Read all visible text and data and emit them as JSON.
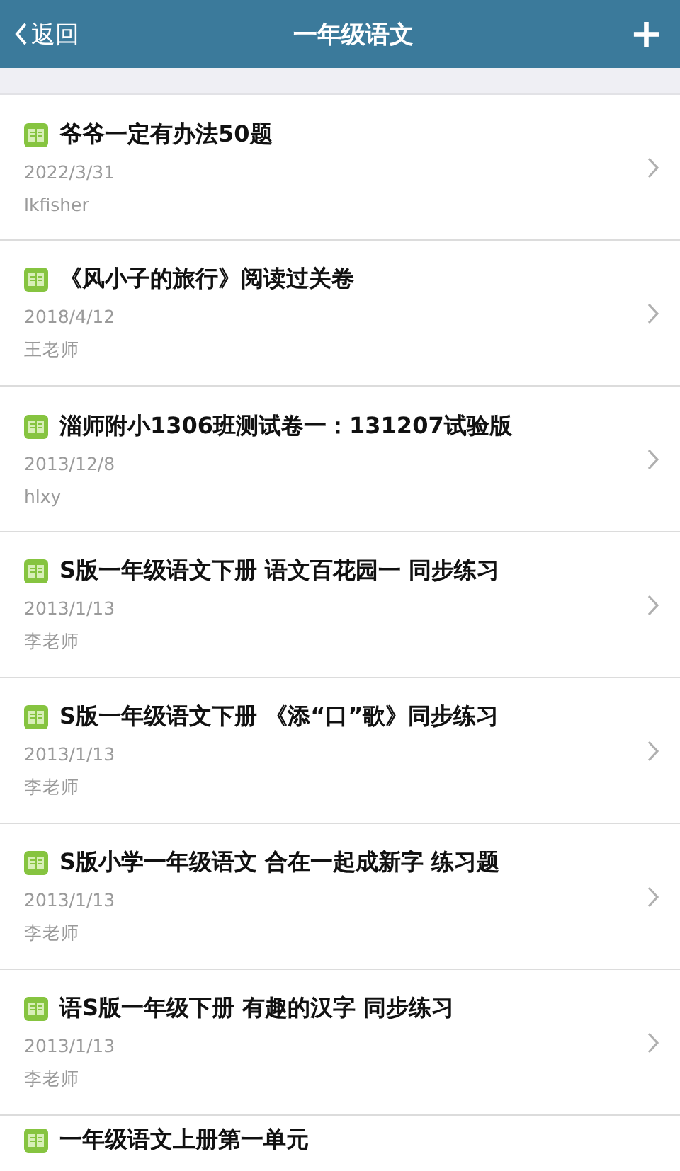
{
  "header": {
    "back": "返回",
    "title": "一年级语文",
    "add": "+"
  },
  "items": [
    {
      "title": "爷爷一定有办法50题",
      "date": "2022/3/31",
      "author": "lkfisher"
    },
    {
      "title": "《风小子的旅行》阅读过关卷",
      "date": "2018/4/12",
      "author": "王老师"
    },
    {
      "title": "淄师附小1306班测试卷一：131207试验版",
      "date": "2013/12/8",
      "author": "hlxy"
    },
    {
      "title": "S版一年级语文下册 语文百花园一 同步练习",
      "date": "2013/1/13",
      "author": "李老师"
    },
    {
      "title": "S版一年级语文下册 《添“口”歌》同步练习",
      "date": "2013/1/13",
      "author": "李老师"
    },
    {
      "title": "S版小学一年级语文 合在一起成新字 练习题",
      "date": "2013/1/13",
      "author": "李老师"
    },
    {
      "title": "语S版一年级下册 有趣的汉字 同步练习",
      "date": "2013/1/13",
      "author": "李老师"
    },
    {
      "title": "一年级语文上册第一单元"
    }
  ]
}
